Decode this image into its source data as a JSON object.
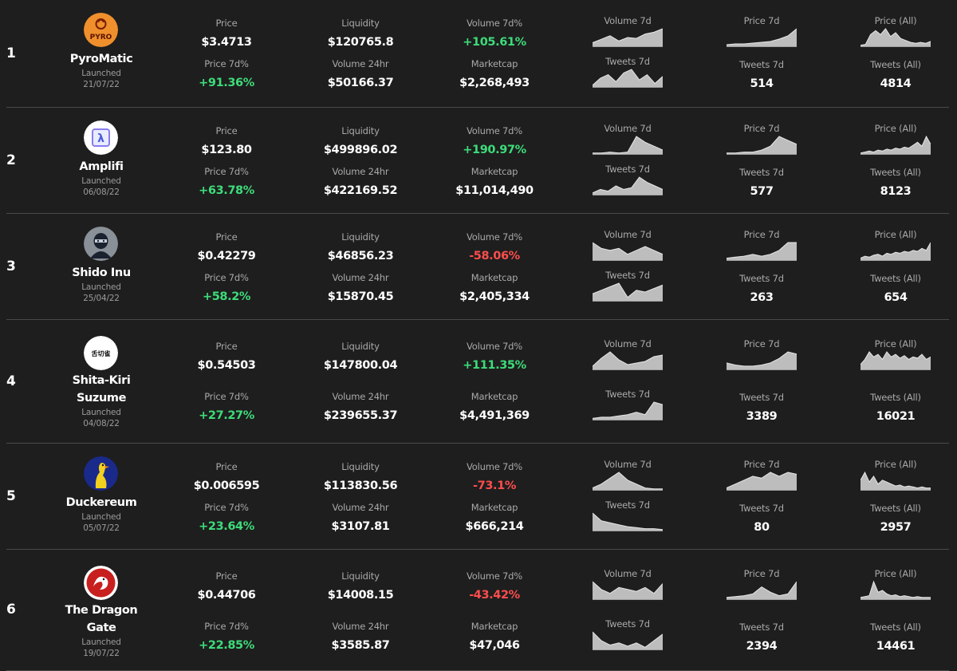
{
  "labels": {
    "price": "Price",
    "liquidity": "Liquidity",
    "volume_7d_pct": "Volume 7d%",
    "price_7d_pct": "Price 7d%",
    "volume_24hr": "Volume 24hr",
    "marketcap": "Marketcap",
    "volume_7d": "Volume 7d",
    "price_7d": "Price 7d",
    "price_all": "Price (All)",
    "tweets_7d": "Tweets 7d",
    "tweets_all": "Tweets (All)",
    "launched": "Launched"
  },
  "colors": {
    "positive": "#3ddc7a",
    "negative": "#ff4d4d",
    "background": "#1e1e1e",
    "separator": "#4a4a4a"
  },
  "rows": [
    {
      "rank": "1",
      "name": "PyroMatic",
      "launched": "21/07/22",
      "price": "$3.4713",
      "liquidity": "$120765.8",
      "volume_7d_pct": "+105.61%",
      "volume_7d_pct_sign": "pos",
      "price_7d_pct": "+91.36%",
      "price_7d_pct_sign": "pos",
      "volume_24hr": "$50166.37",
      "marketcap": "$2,268,493",
      "tweets_7d": "514",
      "tweets_all": "4814",
      "logo_icon": "pyro-logo-icon",
      "logo_color": "#f0902c",
      "spark": {
        "volume_7d": [
          4,
          8,
          12,
          6,
          10,
          9,
          14,
          16,
          20
        ],
        "price_7d": [
          2,
          3,
          3,
          4,
          5,
          6,
          9,
          13,
          22
        ],
        "price_all": [
          1,
          2,
          12,
          16,
          12,
          18,
          10,
          14,
          8,
          6,
          4,
          3,
          4,
          3,
          5
        ],
        "tweets_7d": [
          2,
          10,
          14,
          6,
          16,
          20,
          8,
          14,
          4,
          12
        ]
      }
    },
    {
      "rank": "2",
      "name": "Amplifi",
      "launched": "06/08/22",
      "price": "$123.80",
      "liquidity": "$499896.02",
      "volume_7d_pct": "+190.97%",
      "volume_7d_pct_sign": "pos",
      "price_7d_pct": "+63.78%",
      "price_7d_pct_sign": "pos",
      "volume_24hr": "$422169.52",
      "marketcap": "$11,014,490",
      "tweets_7d": "577",
      "tweets_all": "8123",
      "logo_icon": "amplifi-lambda-icon",
      "logo_color": "#ffffff",
      "spark": {
        "volume_7d": [
          1,
          1,
          2,
          1,
          2,
          18,
          12,
          8,
          4
        ],
        "price_7d": [
          1,
          1,
          2,
          2,
          4,
          8,
          18,
          14,
          10
        ],
        "price_all": [
          1,
          2,
          3,
          2,
          4,
          3,
          5,
          4,
          6,
          5,
          7,
          6,
          9,
          12,
          8,
          18,
          10
        ],
        "tweets_7d": [
          2,
          6,
          4,
          10,
          6,
          8,
          20,
          14,
          10,
          6
        ]
      }
    },
    {
      "rank": "3",
      "name": "Shido Inu",
      "launched": "25/04/22",
      "price": "$0.42279",
      "liquidity": "$46856.23",
      "volume_7d_pct": "-58.06%",
      "volume_7d_pct_sign": "neg",
      "price_7d_pct": "+58.2%",
      "price_7d_pct_sign": "pos",
      "volume_24hr": "$15870.45",
      "marketcap": "$2,405,334",
      "tweets_7d": "263",
      "tweets_all": "654",
      "logo_icon": "shido-ninja-icon",
      "logo_color": "#2a3340",
      "spark": {
        "volume_7d": [
          18,
          12,
          10,
          12,
          6,
          10,
          14,
          10,
          6
        ],
        "price_7d": [
          2,
          3,
          4,
          6,
          4,
          6,
          10,
          18,
          18
        ],
        "price_all": [
          2,
          4,
          3,
          5,
          6,
          4,
          7,
          6,
          8,
          7,
          9,
          8,
          10,
          9,
          12,
          10,
          18
        ],
        "tweets_7d": [
          8,
          12,
          16,
          20,
          4,
          12,
          10,
          14,
          18
        ]
      }
    },
    {
      "rank": "4",
      "name": "Shita-Kiri Suzume",
      "launched": "04/08/22",
      "price": "$0.54503",
      "liquidity": "$147800.04",
      "volume_7d_pct": "+111.35%",
      "volume_7d_pct_sign": "pos",
      "price_7d_pct": "+27.27%",
      "price_7d_pct_sign": "pos",
      "volume_24hr": "$239655.37",
      "marketcap": "$4,491,369",
      "tweets_7d": "3389",
      "tweets_all": "16021",
      "logo_icon": "suzume-kanji-icon",
      "logo_color": "#ffffff",
      "spark": {
        "volume_7d": [
          4,
          14,
          22,
          12,
          6,
          8,
          10,
          16,
          18
        ],
        "price_7d": [
          6,
          4,
          3,
          3,
          4,
          6,
          10,
          16,
          14
        ],
        "price_all": [
          4,
          8,
          14,
          10,
          12,
          8,
          14,
          10,
          12,
          9,
          11,
          8,
          10,
          9,
          12,
          8,
          10
        ],
        "tweets_7d": [
          1,
          2,
          2,
          3,
          4,
          6,
          4,
          14,
          12
        ]
      }
    },
    {
      "rank": "5",
      "name": "Duckereum",
      "launched": "05/07/22",
      "price": "$0.006595",
      "liquidity": "$113830.56",
      "volume_7d_pct": "-73.1%",
      "volume_7d_pct_sign": "neg",
      "price_7d_pct": "+23.64%",
      "price_7d_pct_sign": "pos",
      "volume_24hr": "$3107.81",
      "marketcap": "$666,214",
      "tweets_7d": "80",
      "tweets_all": "2957",
      "logo_icon": "duck-icon",
      "logo_color": "#1a2a8a",
      "spark": {
        "volume_7d": [
          2,
          6,
          12,
          18,
          10,
          6,
          2,
          1,
          1
        ],
        "price_7d": [
          2,
          6,
          10,
          14,
          12,
          18,
          14,
          18,
          16
        ],
        "price_all": [
          10,
          18,
          8,
          14,
          6,
          10,
          8,
          6,
          4,
          5,
          3,
          4,
          3,
          2,
          3,
          2,
          2
        ],
        "tweets_7d": [
          18,
          10,
          8,
          6,
          4,
          3,
          2,
          2,
          1
        ]
      }
    },
    {
      "rank": "6",
      "name": "The Dragon Gate",
      "launched": "19/07/22",
      "price": "$0.44706",
      "liquidity": "$14008.15",
      "volume_7d_pct": "-43.42%",
      "volume_7d_pct_sign": "neg",
      "price_7d_pct": "+22.85%",
      "price_7d_pct_sign": "pos",
      "volume_24hr": "$3585.87",
      "marketcap": "$47,046",
      "tweets_7d": "2394",
      "tweets_all": "14461",
      "logo_icon": "dragon-gate-icon",
      "logo_color": "#c8201e",
      "spark": {
        "volume_7d": [
          18,
          10,
          6,
          12,
          10,
          8,
          12,
          6,
          16
        ],
        "price_7d": [
          2,
          3,
          4,
          6,
          14,
          8,
          4,
          6,
          20
        ],
        "price_all": [
          2,
          3,
          4,
          20,
          8,
          10,
          6,
          4,
          5,
          3,
          4,
          3,
          2,
          3,
          2,
          2,
          2
        ],
        "tweets_7d": [
          16,
          8,
          4,
          6,
          3,
          6,
          2,
          8,
          14
        ]
      }
    }
  ]
}
